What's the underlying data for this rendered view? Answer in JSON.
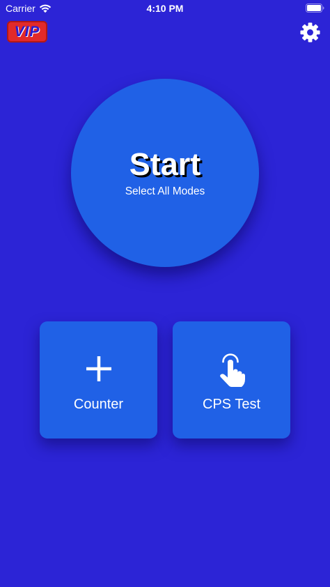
{
  "status_bar": {
    "carrier": "Carrier",
    "time": "4:10 PM",
    "icons": [
      "wifi-icon",
      "battery-icon"
    ]
  },
  "header": {
    "logo_text": "VIP",
    "settings_icon": "gear-icon"
  },
  "start": {
    "title": "Start",
    "subtitle": "Select All Modes"
  },
  "modes": [
    {
      "label": "Counter",
      "icon": "plus-icon"
    },
    {
      "label": "CPS Test",
      "icon": "hand-tap-icon"
    }
  ],
  "colors": {
    "background": "#2c24d6",
    "button": "#2061e6",
    "logo_red": "#e22a2a",
    "text": "#ffffff"
  }
}
